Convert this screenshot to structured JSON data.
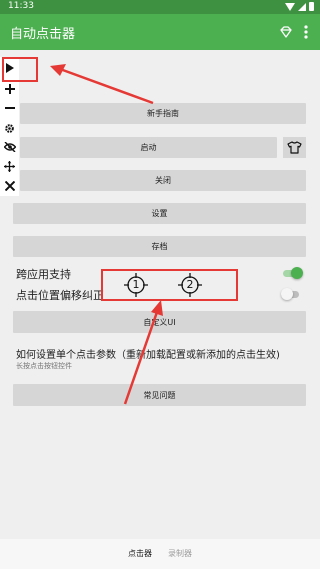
{
  "status_bar": {
    "time": "11:33"
  },
  "app_bar": {
    "title": "自动点击器",
    "actions": [
      "gem-icon",
      "more-vert-icon"
    ]
  },
  "floating_toolbar": {
    "tools": [
      "play-icon",
      "plus-icon",
      "minus-icon",
      "gear-icon",
      "eye-off-icon",
      "move-icon",
      "close-icon"
    ]
  },
  "buttons": {
    "guide": "新手指南",
    "start": "启动",
    "close": "关闭",
    "settings": "设置",
    "save": "存档",
    "custom_ui": "自定义UI",
    "faq": "常见问题"
  },
  "toggles": [
    {
      "label": "跨应用支持",
      "on": true
    },
    {
      "label": "点击位置偏移纠正",
      "on": false
    }
  ],
  "targets": [
    "1",
    "2"
  ],
  "help": {
    "title": "如何设置单个点击参数（重新加载配置或新添加的点击生效)",
    "subtitle": "长按点击按钮控件"
  },
  "bottom_nav": {
    "items": [
      {
        "label": "点击器",
        "active": true
      },
      {
        "label": "录制器",
        "active": false
      }
    ]
  },
  "colors": {
    "status_bar": "#3d9140",
    "app_bar": "#4caf50",
    "accent": "#4caf50",
    "annotation": "#e53935"
  }
}
